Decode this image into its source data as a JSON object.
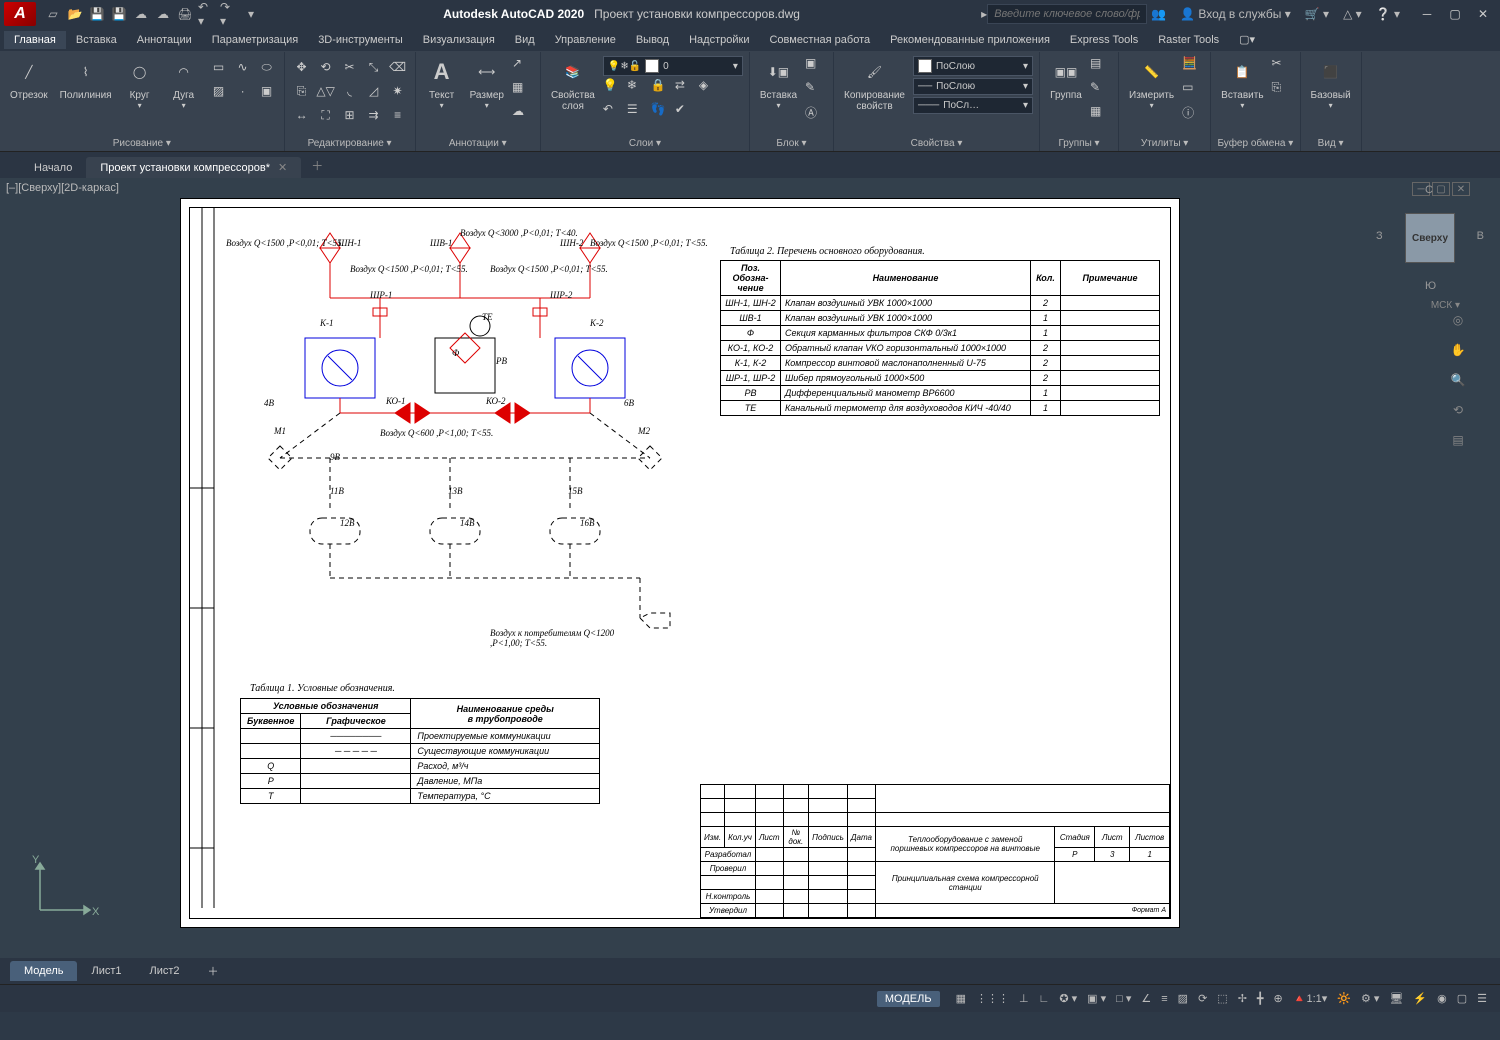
{
  "title": {
    "app": "Autodesk AutoCAD 2020",
    "doc": "Проект установки компрессоров.dwg"
  },
  "search": {
    "placeholder": "Введите ключевое слово/фразу"
  },
  "login": "Вход в службы",
  "menubar": [
    "Главная",
    "Вставка",
    "Аннотации",
    "Параметризация",
    "3D-инструменты",
    "Визуализация",
    "Вид",
    "Управление",
    "Вывод",
    "Надстройки",
    "Совместная работа",
    "Рекомендованные приложения",
    "Express Tools",
    "Raster Tools"
  ],
  "ribbon": {
    "draw": {
      "line": "Отрезок",
      "polyline": "Полилиния",
      "circle": "Круг",
      "arc": "Дуга",
      "title": "Рисование ▾"
    },
    "edit": {
      "title": "Редактирование ▾"
    },
    "anno": {
      "text": "Текст",
      "dim": "Размер",
      "title": "Аннотации ▾"
    },
    "layers": {
      "props": "Свойства\nслоя",
      "current": "0",
      "title": "Слои ▾"
    },
    "block": {
      "insert": "Вставка",
      "title": "Блок ▾"
    },
    "props": {
      "match": "Копирование\nсвойств",
      "bylayer1": "ПоСлою",
      "bylayer2": "ПоСлою",
      "bylayer3": "ПоСл…",
      "title": "Свойства ▾"
    },
    "group": {
      "label": "Группа",
      "title": "Группы ▾"
    },
    "util": {
      "label": "Измерить",
      "title": "Утилиты ▾"
    },
    "clip": {
      "label": "Вставить",
      "title": "Буфер обмена ▾"
    },
    "view": {
      "label": "Базовый",
      "title": "Вид ▾"
    }
  },
  "doctabs": {
    "start": "Начало",
    "active": "Проект установки компрессоров*"
  },
  "viewport": {
    "label": "[–][Сверху][2D-каркас]",
    "cube": "Сверху",
    "c": "С",
    "w": "З",
    "e": "В",
    "s": "Ю",
    "wcs": "МСК ▾"
  },
  "drawing": {
    "air_labels": {
      "a1": "Воздух Q<1500 ,P<0,01; T<55.",
      "a2": "ШН-1",
      "a3": "ШВ-1",
      "a4": "Воздух Q<3000 ,P<0,01; T<40.",
      "a5": "ШН-2",
      "a6": "Воздух Q<1500 ,P<0,01; T<55.",
      "b1": "Воздух Q<1500 ,P<0,01; T<55.",
      "b2": "ШР-1",
      "b3": "Воздух Q<1500 ,P<0,01; T<55.",
      "b4": "ШР-2",
      "k1": "К-1",
      "ko1": "КО-1",
      "ko2": "КО-2",
      "k2": "К-2",
      "f": "Ф",
      "rv": "РВ",
      "te": "TE",
      "v48": "4В",
      "v68": "6В",
      "m1": "М1",
      "m2": "М2",
      "v98": "9В",
      "out": "Воздух Q<600 ,P<1,00; T<55.",
      "v118": "11В",
      "v128": "12В",
      "v138": "13В",
      "v148": "14В",
      "v158": "15В",
      "v168": "16В",
      "consumer": "Воздух к потребителям Q<1200 ,P<1,00; T<55."
    },
    "table2": {
      "title": "Таблица 2. Перечень основного оборудования.",
      "head": [
        "Поз.\nОбозна-\nчение",
        "Наименование",
        "Кол.",
        "Примечание"
      ],
      "rows": [
        [
          "ШН-1, ШН-2",
          "Клапан воздушный УВК 1000×1000",
          "2",
          ""
        ],
        [
          "ШВ-1",
          "Клапан воздушный УВК 1000×1000",
          "1",
          ""
        ],
        [
          "Ф",
          "Секция карманных фильтров СКФ 0/3к1",
          "1",
          ""
        ],
        [
          "КО-1, КО-2",
          "Обратный клапан VКO горизонтальный 1000×1000",
          "2",
          ""
        ],
        [
          "К-1, К-2",
          "Компрессор винтовой маслонаполненный U-75",
          "2",
          ""
        ],
        [
          "ШР-1, ШР-2",
          "Шибер прямоугольный 1000×500",
          "2",
          ""
        ],
        [
          "РВ",
          "Дифференциальный манометр ВР6600",
          "1",
          ""
        ],
        [
          "ТЕ",
          "Канальный термометр для воздуховодов КИЧ -40/40",
          "1",
          ""
        ]
      ]
    },
    "table1": {
      "title": "Таблица 1. Условные обозначения.",
      "head1": "Условные обозначения",
      "head2": "Наименование среды\nв трубопроводе",
      "sub1": "Буквенное",
      "sub2": "Графическое",
      "rows": [
        [
          "",
          "────────",
          "Проектируемые коммуникации"
        ],
        [
          "",
          "─ ─ ─ ─ ─",
          "Существующие коммуникации"
        ],
        [
          "Q",
          "",
          "Расход, м³/ч"
        ],
        [
          "P",
          "",
          "Давление, МПа"
        ],
        [
          "T",
          "",
          "Температура, °C"
        ]
      ]
    },
    "stamp": {
      "r1": [
        "Изм.",
        "Кол.уч",
        "Лист",
        "№ док.",
        "Подпись",
        "Дата"
      ],
      "r2_1": "Разработал",
      "r2_2": "Проверил",
      "r2_3": "Н.контроль",
      "r2_4": "Утвердил",
      "title1": "Теплооборудование с заменой\nпоршневых компрессоров на винтовые",
      "title2": "Принципиальная схема компрессорной\nстанции",
      "cols": [
        "Стадия",
        "Лист",
        "Листов"
      ],
      "vals": [
        "Р",
        "3",
        "1"
      ],
      "form": "Формат А"
    }
  },
  "sheettabs": [
    "Модель",
    "Лист1",
    "Лист2"
  ],
  "status": {
    "model": "МОДЕЛЬ",
    "scale": "1:1"
  }
}
